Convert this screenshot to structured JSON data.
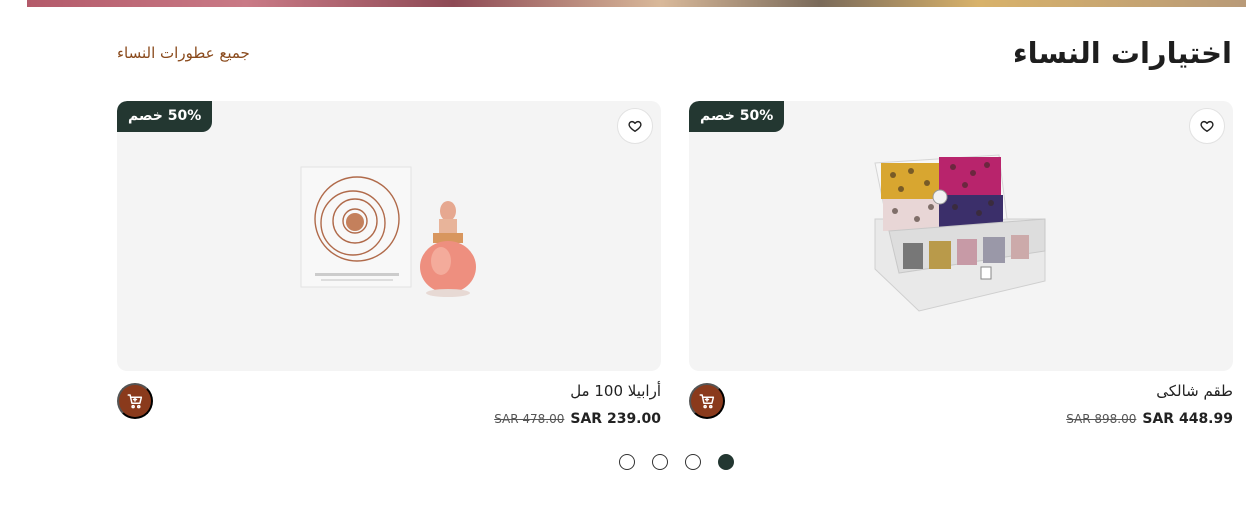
{
  "section": {
    "title": "اختيارات النساء",
    "view_all_label": "جميع عطورات النساء"
  },
  "products": [
    {
      "name": "طقم شالكى",
      "badge": "50% خصم",
      "old_price": "SAR 898.00",
      "new_price": "SAR 448.99",
      "wishlist_icon": "heart-icon",
      "cart_icon": "cart-icon"
    },
    {
      "name": "أرابيلا 100 مل",
      "badge": "50% خصم",
      "old_price": "SAR 478.00",
      "new_price": "SAR 239.00",
      "wishlist_icon": "heart-icon",
      "cart_icon": "cart-icon"
    }
  ],
  "carousel": {
    "page_count": 4,
    "active_index": 3
  },
  "colors": {
    "accent": "#8a3a1c",
    "badge_bg": "#233731",
    "link": "#8a4a1c",
    "card_bg": "#f4f4f4"
  }
}
